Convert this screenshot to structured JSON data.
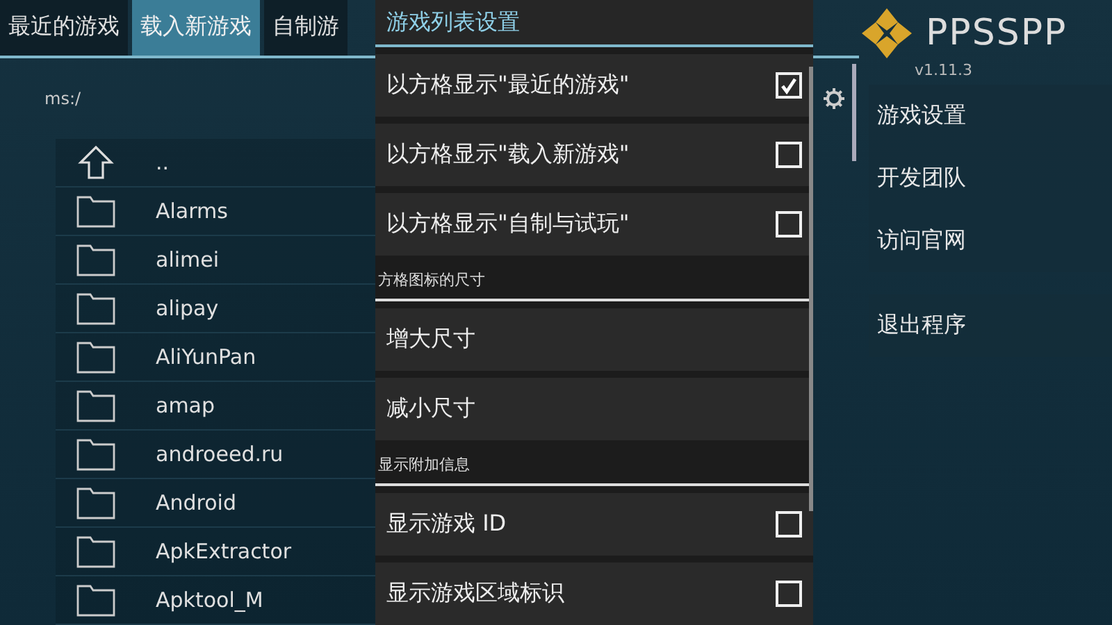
{
  "tabs": [
    {
      "label": "最近的游戏",
      "selected": false
    },
    {
      "label": "载入新游戏",
      "selected": true
    },
    {
      "label": "自制游",
      "selected": false
    }
  ],
  "path": "ms:/",
  "files": [
    {
      "kind": "up",
      "name": ".."
    },
    {
      "kind": "folder",
      "name": "Alarms"
    },
    {
      "kind": "folder",
      "name": "alimei"
    },
    {
      "kind": "folder",
      "name": "alipay"
    },
    {
      "kind": "folder",
      "name": "AliYunPan"
    },
    {
      "kind": "folder",
      "name": "amap"
    },
    {
      "kind": "folder",
      "name": "androeed.ru"
    },
    {
      "kind": "folder",
      "name": "Android"
    },
    {
      "kind": "folder",
      "name": "ApkExtractor"
    },
    {
      "kind": "folder",
      "name": "Apktool_M"
    }
  ],
  "logo": {
    "name": "PPSSPP",
    "version": "v1.11.3"
  },
  "menu": [
    {
      "label": "游戏设置"
    },
    {
      "label": "开发团队"
    },
    {
      "label": "访问官网"
    }
  ],
  "exit": {
    "label": "退出程序"
  },
  "dialog": {
    "title": "游戏列表设置",
    "items": [
      {
        "kind": "checkbox",
        "label": "以方格显示\"最近的游戏\"",
        "checked": true
      },
      {
        "kind": "checkbox",
        "label": "以方格显示\"载入新游戏\"",
        "checked": false
      },
      {
        "kind": "checkbox",
        "label": "以方格显示\"自制与试玩\"",
        "checked": false
      },
      {
        "kind": "header",
        "label": "方格图标的尺寸"
      },
      {
        "kind": "button",
        "label": "增大尺寸"
      },
      {
        "kind": "button",
        "label": "减小尺寸"
      },
      {
        "kind": "header",
        "label": "显示附加信息"
      },
      {
        "kind": "checkbox",
        "label": "显示游戏 ID",
        "checked": false
      },
      {
        "kind": "checkbox",
        "label": "显示游戏区域标识",
        "checked": false
      }
    ]
  }
}
